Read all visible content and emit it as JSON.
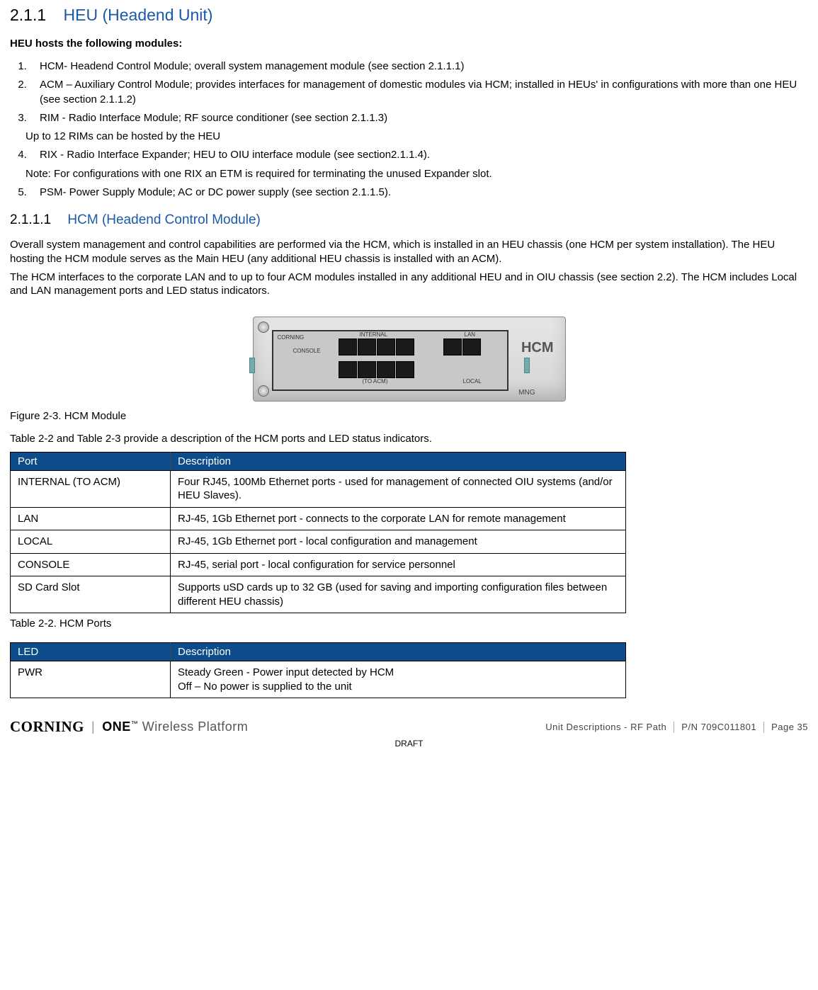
{
  "section211": {
    "number": "2.1.1",
    "title": "HEU (Headend Unit)"
  },
  "hosts_line": "HEU hosts the following modules:",
  "modules": [
    "HCM- Headend Control Module; overall system management module (see section 2.1.1.1)",
    "ACM – Auxiliary Control Module; provides interfaces for management of domestic modules via HCM; installed in HEUs' in configurations with more than one HEU (see section 2.1.1.2)",
    "RIM - Radio Interface Module; RF source conditioner (see section 2.1.1.3)",
    "RIX - Radio Interface Expander; HEU to OIU interface module (see section2.1.1.4).",
    "PSM- Power Supply Module; AC or DC power supply (see section 2.1.1.5)."
  ],
  "sub_after_3": "Up to 12 RIMs can be hosted by the HEU",
  "sub_after_4": "Note: For configurations with one RIX an ETM is required for terminating the unused Expander slot.",
  "section2111": {
    "number": "2.1.1.1",
    "title": "HCM (Headend Control Module)"
  },
  "para1": "Overall system management and control capabilities are performed via the HCM, which is installed in an HEU chassis (one HCM per system installation). The HEU hosting the HCM module serves as the Main HEU (any additional HEU chassis is installed with an ACM).",
  "para2": "The HCM interfaces to the corporate LAN and to up to four ACM modules installed in any additional HEU and in OIU chassis (see section 2.2). The HCM includes Local and LAN management ports and LED status indicators.",
  "hcm_panel": {
    "brand": "CORNING",
    "console": "CONSOLE",
    "internal": "INTERNAL",
    "lan": "LAN",
    "toacm": "(TO ACM)",
    "local": "LOCAL",
    "hcm": "HCM",
    "mng": "MNG"
  },
  "figure_caption": "Figure 2-3. HCM Module",
  "table_intro": "Table 2-2 and Table 2-3 provide a description of the HCM ports and LED status indicators.",
  "ports_table": {
    "headers": [
      "Port",
      "Description"
    ],
    "rows": [
      [
        "INTERNAL (TO ACM)",
        "Four RJ45, 100Mb Ethernet ports - used for management of connected OIU systems (and/or HEU Slaves)."
      ],
      [
        "LAN",
        "RJ-45, 1Gb Ethernet port - connects to the corporate LAN for remote management"
      ],
      [
        "LOCAL",
        "RJ-45, 1Gb Ethernet port - local configuration and management"
      ],
      [
        "CONSOLE",
        "RJ-45, serial port - local configuration for service personnel"
      ],
      [
        "SD Card Slot",
        "Supports uSD cards up to 32 GB (used for saving and importing configuration files between different HEU chassis)"
      ]
    ]
  },
  "ports_caption": "Table 2-2. HCM Ports",
  "led_table": {
    "headers": [
      "LED",
      "Description"
    ],
    "rows": [
      [
        "PWR",
        "Steady Green - Power input detected by HCM\nOff – No power is supplied to the unit"
      ]
    ]
  },
  "footer": {
    "logo_corning": "CORNING",
    "logo_one": "ONE",
    "logo_wp": "Wireless Platform",
    "path": "Unit Descriptions - RF Path",
    "pn": "P/N 709C011801",
    "page": "Page 35",
    "draft": "DRAFT"
  }
}
